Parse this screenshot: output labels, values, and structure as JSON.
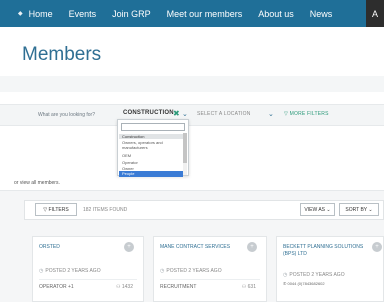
{
  "nav": {
    "items": [
      {
        "label": "Home",
        "icon": "home-icon"
      },
      {
        "label": "Events"
      },
      {
        "label": "Join GRP"
      },
      {
        "label": "Meet our members"
      },
      {
        "label": "About us"
      },
      {
        "label": "News"
      },
      {
        "label": "A"
      }
    ]
  },
  "page": {
    "title": "Members"
  },
  "search": {
    "question": "What are you looking for?",
    "category_value": "CONSTRUCTION",
    "clear_symbol": "✖",
    "chevron": "⌄",
    "location_placeholder": "SELECT A LOCATION",
    "more_filters": "▽ MORE FILTERS"
  },
  "dropdown": {
    "options": [
      {
        "label": "Construction",
        "state": "header"
      },
      {
        "label": "Owners, operators and manufacturers",
        "state": "normal"
      },
      {
        "label": "OEM",
        "state": "normal"
      },
      {
        "label": "Operator",
        "state": "normal"
      },
      {
        "label": "Owner",
        "state": "normal"
      },
      {
        "label": "People",
        "state": "selected"
      }
    ]
  },
  "view_all": "or view all members.",
  "toolbar": {
    "filters_label": "▽ FILTERS",
    "items_found": "182 ITEMS FOUND",
    "view_as": "VIEW AS ⌄",
    "sort_by": "SORT BY ⌄"
  },
  "cards": [
    {
      "name": "ORSTED",
      "badge": "+",
      "posted": "POSTED 2 YEARS AGO",
      "role": "OPERATOR +1",
      "count": "1432"
    },
    {
      "name": "MANE CONTRACT SERVICES",
      "badge": "+",
      "posted": "POSTED 2 YEARS AGO",
      "role": "RECRUITMENT",
      "count": "631"
    },
    {
      "name": "BECKETT PLANNING SOLUTIONS (BPS) LTD",
      "badge": "+",
      "posted": "POSTED 2 YEARS AGO",
      "phone": "0044 (0)7843682602"
    }
  ],
  "colors": {
    "nav_bg": "#1f6f98",
    "title": "#2f6f93",
    "accent_green": "#2c9a7a",
    "selected_option": "#3a7bd5"
  }
}
